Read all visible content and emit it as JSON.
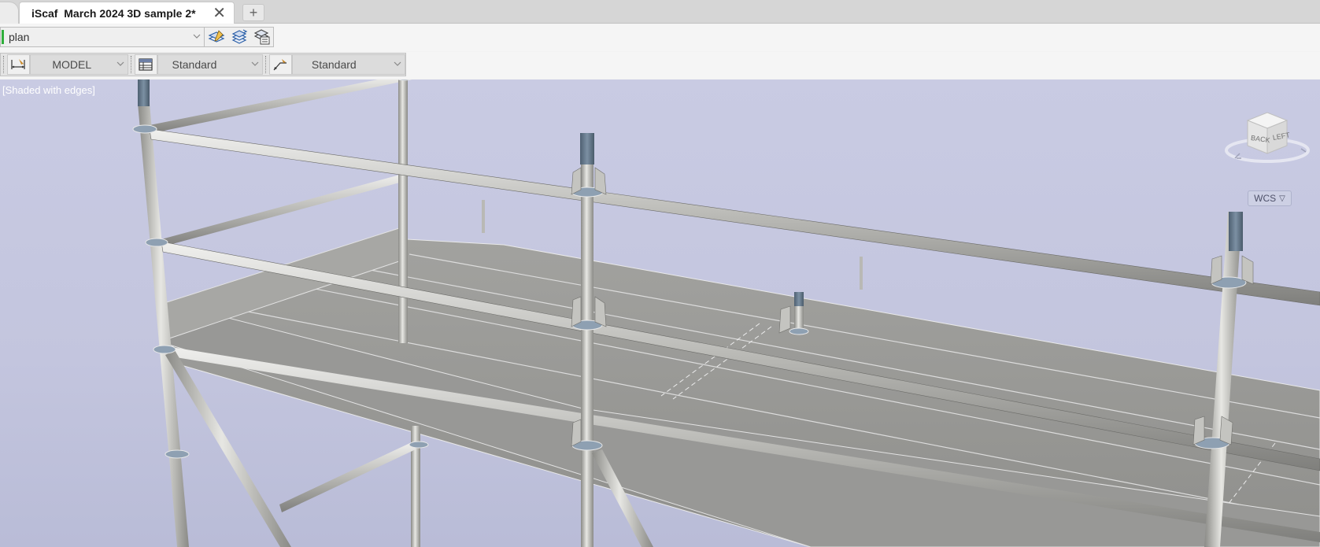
{
  "tabs": {
    "document_title": "iScaf  March 2024 3D sample 2*",
    "close_glyph": "✕",
    "new_tab_glyph": "+"
  },
  "toolbar_row1": {
    "layer_value": "plan",
    "layer_swatch_color": "#2fae3b",
    "tools": [
      "layer-properties-icon",
      "layer-states-icon",
      "layer-list-icon"
    ]
  },
  "toolbar_row2": {
    "space_value": "MODEL",
    "table_style_value": "Standard",
    "multileader_style_value": "Standard",
    "icons": [
      "dimension-style-icon",
      "table-style-icon",
      "multileader-style-icon"
    ]
  },
  "viewport": {
    "visual_style_label": "[Shaded with edges]",
    "viewcube": {
      "face_back": "BACK",
      "face_left": "LEFT"
    },
    "ucs_button": {
      "label": "WCS",
      "arrow": "▽"
    },
    "background_top": "#c9cbe3",
    "background_bottom": "#b9bcd7"
  }
}
